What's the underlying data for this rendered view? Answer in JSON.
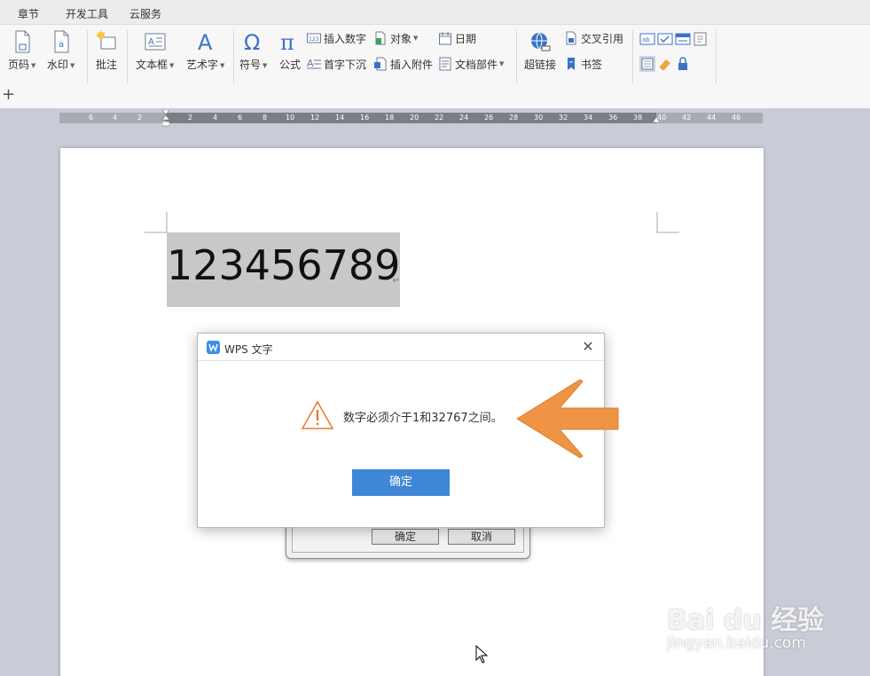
{
  "menu": {
    "tabs": [
      "章节",
      "开发工具",
      "云服务"
    ]
  },
  "ribbon": {
    "big_buttons": {
      "page_number": "页码",
      "watermark": "水印",
      "comment": "批注",
      "text_box": "文本框",
      "word_art": "艺术字",
      "symbol": "符号",
      "formula": "公式",
      "hyperlink": "超链接"
    },
    "small_buttons": {
      "insert_number": "插入数字",
      "object": "对象",
      "date": "日期",
      "drop_cap": "首字下沉",
      "insert_attachment": "插入附件",
      "doc_parts": "文档部件",
      "cross_reference": "交叉引用",
      "bookmark": "书签"
    },
    "number_icon_text": "123"
  },
  "ruler": {
    "ticks": [
      "6",
      "4",
      "2",
      "2",
      "4",
      "6",
      "8",
      "10",
      "12",
      "14",
      "16",
      "18",
      "20",
      "22",
      "24",
      "26",
      "28",
      "30",
      "32",
      "34",
      "36",
      "38",
      "40",
      "42",
      "44",
      "46"
    ]
  },
  "document": {
    "selected_text": "123456789",
    "paragraph_mark": "↵"
  },
  "underlying_dialog": {
    "ok_label": "确定",
    "cancel_label": "取消"
  },
  "dialog": {
    "title": "WPS 文字",
    "message": "数字必须介于1和32767之间。",
    "ok_label": "确定",
    "close_glyph": "✕",
    "warning_icon": "warning-triangle-icon"
  },
  "watermark": {
    "brand": "Bai du 经验",
    "site": "jingyan.baidu.com"
  },
  "colors": {
    "accent_blue": "#3f86d6",
    "annotation_arrow": "#ee9444",
    "warning_orange": "#e8782b"
  }
}
